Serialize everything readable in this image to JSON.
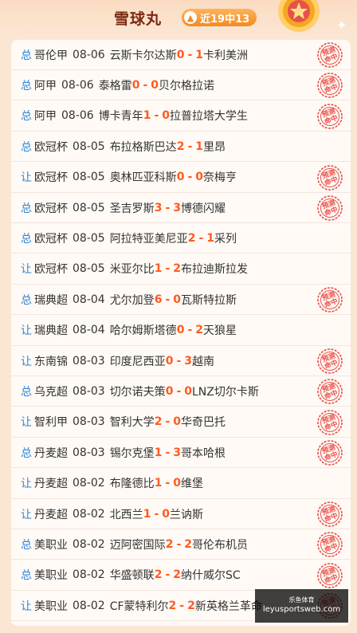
{
  "header": {
    "title": "雪球丸",
    "streak_label": "近19中13",
    "streak_icon": "up-arrow-icon"
  },
  "matches": [
    {
      "type": "总",
      "league": "哥伦甲",
      "date": "08-06",
      "home": "云斯卡尔达斯",
      "home_score": "0",
      "away_score": "1",
      "away": "卡利美洲",
      "hit": true
    },
    {
      "type": "总",
      "league": "阿甲",
      "date": "08-06",
      "home": "泰格雷",
      "home_score": "0",
      "away_score": "0",
      "away": "贝尔格拉诺",
      "hit": true
    },
    {
      "type": "总",
      "league": "阿甲",
      "date": "08-06",
      "home": "博卡青年",
      "home_score": "1",
      "away_score": "0",
      "away": "拉普拉塔大学生",
      "hit": true
    },
    {
      "type": "总",
      "league": "欧冠杯",
      "date": "08-05",
      "home": "布拉格斯巴达",
      "home_score": "2",
      "away_score": "1",
      "away": "里昂",
      "hit": false
    },
    {
      "type": "让",
      "league": "欧冠杯",
      "date": "08-05",
      "home": "奥林匹亚科斯",
      "home_score": "0",
      "away_score": "0",
      "away": "奈梅亨",
      "hit": true
    },
    {
      "type": "总",
      "league": "欧冠杯",
      "date": "08-05",
      "home": "圣吉罗斯",
      "home_score": "3",
      "away_score": "3",
      "away": "博德闪耀",
      "hit": true
    },
    {
      "type": "总",
      "league": "欧冠杯",
      "date": "08-05",
      "home": "阿拉特亚美尼亚",
      "home_score": "2",
      "away_score": "1",
      "away": "采列",
      "hit": false
    },
    {
      "type": "让",
      "league": "欧冠杯",
      "date": "08-05",
      "home": "米亚尔比",
      "home_score": "1",
      "away_score": "2",
      "away": "布拉迪斯拉发",
      "hit": false
    },
    {
      "type": "总",
      "league": "瑞典超",
      "date": "08-04",
      "home": "尤尔加登",
      "home_score": "6",
      "away_score": "0",
      "away": "瓦斯特拉斯",
      "hit": true
    },
    {
      "type": "让",
      "league": "瑞典超",
      "date": "08-04",
      "home": "哈尔姆斯塔德",
      "home_score": "0",
      "away_score": "2",
      "away": "天狼星",
      "hit": false
    },
    {
      "type": "让",
      "league": "东南锦",
      "date": "08-03",
      "home": "印度尼西亚",
      "home_score": "0",
      "away_score": "3",
      "away": "越南",
      "hit": true
    },
    {
      "type": "总",
      "league": "乌克超",
      "date": "08-03",
      "home": "切尔诺夫策",
      "home_score": "0",
      "away_score": "0",
      "away": "LNZ切尔卡斯",
      "hit": true
    },
    {
      "type": "让",
      "league": "智利甲",
      "date": "08-03",
      "home": "智利大学",
      "home_score": "2",
      "away_score": "0",
      "away": "华奇巴托",
      "hit": true
    },
    {
      "type": "总",
      "league": "丹麦超",
      "date": "08-03",
      "home": "锡尔克堡",
      "home_score": "1",
      "away_score": "3",
      "away": "哥本哈根",
      "hit": true
    },
    {
      "type": "让",
      "league": "丹麦超",
      "date": "08-02",
      "home": "布隆德比",
      "home_score": "1",
      "away_score": "0",
      "away": "维堡",
      "hit": false
    },
    {
      "type": "让",
      "league": "丹麦超",
      "date": "08-02",
      "home": "北西兰",
      "home_score": "1",
      "away_score": "0",
      "away": "兰讷斯",
      "hit": true
    },
    {
      "type": "总",
      "league": "美职业",
      "date": "08-02",
      "home": "迈阿密国际",
      "home_score": "2",
      "away_score": "2",
      "away": "哥伦布机员",
      "hit": true
    },
    {
      "type": "总",
      "league": "美职业",
      "date": "08-02",
      "home": "华盛顿联",
      "home_score": "2",
      "away_score": "2",
      "away": "纳什威尔SC",
      "hit": true
    },
    {
      "type": "让",
      "league": "美职业",
      "date": "08-02",
      "home": "CF蒙特利尔",
      "home_score": "2",
      "away_score": "2",
      "away": "新英格兰革命",
      "hit": true
    }
  ],
  "stamp": {
    "line1": "预测",
    "line2": "命中",
    "color": "#e8504a"
  },
  "watermark": {
    "top": "乐鱼体育",
    "bottom": "leyusportsweb.com"
  },
  "colors": {
    "accent": "#ff5a1f",
    "type_blue": "#2f86d9",
    "title": "#7a2a12"
  }
}
